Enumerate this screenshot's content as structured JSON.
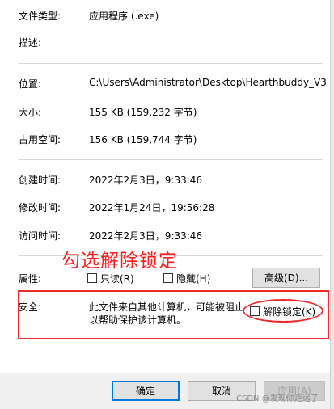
{
  "properties": {
    "file_type_label": "文件类型:",
    "file_type_value": "应用程序 (.exe)",
    "description_label": "描述:",
    "location_label": "位置:",
    "location_value": "C:\\Users\\Administrator\\Desktop\\Hearthbuddy_V3",
    "size_label": "大小:",
    "size_value": "155 KB (159,232 字节)",
    "size_on_disk_label": "占用空间:",
    "size_on_disk_value": "156 KB (159,744 字节)",
    "created_label": "创建时间:",
    "created_value": "2022年2月3日，9:33:46",
    "modified_label": "修改时间:",
    "modified_value": "2022年1月24日，19:56:28",
    "accessed_label": "访问时间:",
    "accessed_value": "2022年2月3日，9:33:46"
  },
  "attributes": {
    "label": "属性:",
    "readonly_label": "只读(R)",
    "readonly_checked": false,
    "hidden_label": "隐藏(H)",
    "hidden_checked": false,
    "advanced_button": "高级(D)..."
  },
  "security": {
    "label": "安全:",
    "message_line1": "此文件来自其他计算机，可能被阻止",
    "message_line2": "以帮助保护该计算机。",
    "unblock_label": "解除锁定(K)",
    "unblock_checked": false
  },
  "annotation": {
    "text": "勾选解除锁定",
    "color": "#ff1e1e"
  },
  "footer": {
    "ok": "确定",
    "cancel": "取消",
    "apply": "应用(A)",
    "watermark": "CSDN @发现你走远了"
  }
}
